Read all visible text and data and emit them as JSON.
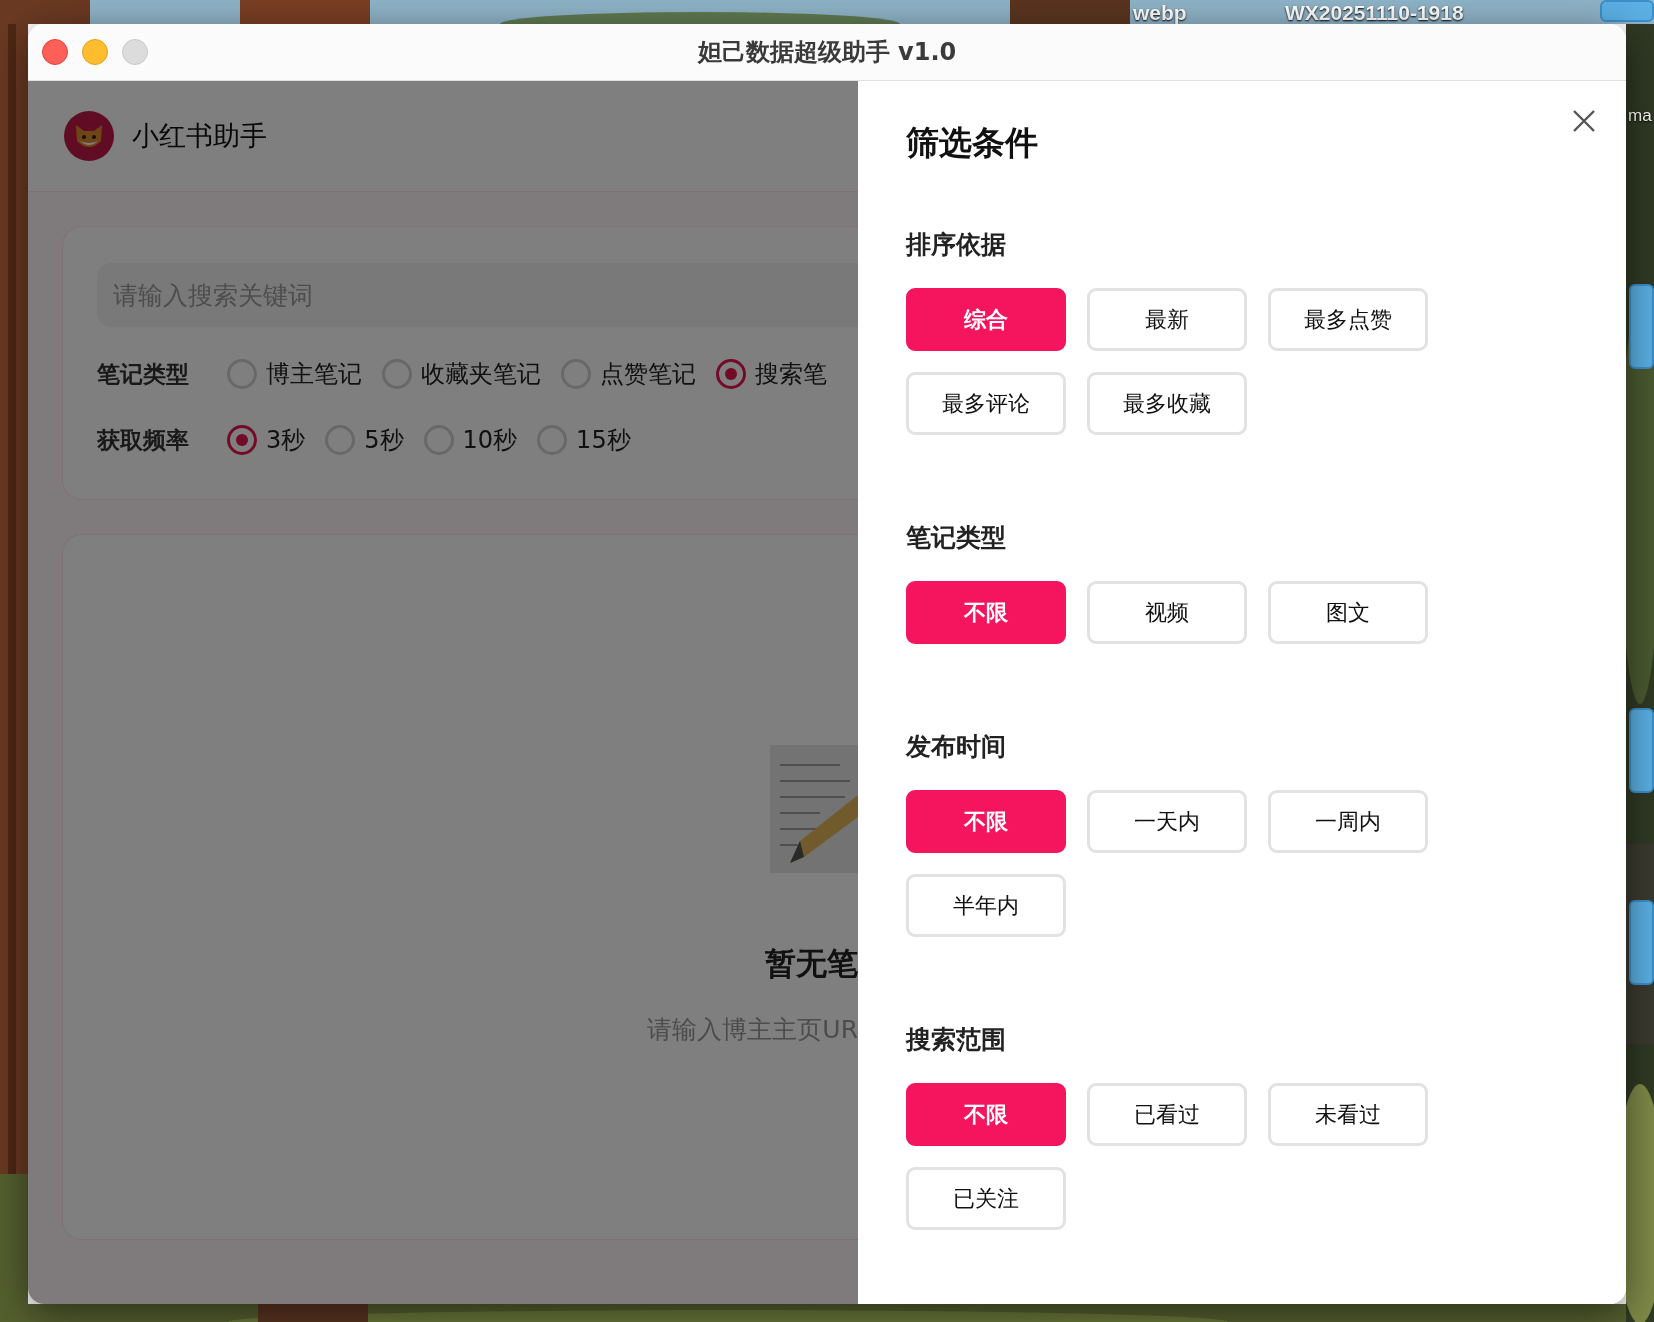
{
  "desktop": {
    "labels": [
      "webp",
      "WX20251110-1918",
      "ma"
    ]
  },
  "window": {
    "title": "妲己数据超级助手 v1.0"
  },
  "app": {
    "name": "小红书助手"
  },
  "search": {
    "placeholder": "请输入搜索关键词"
  },
  "options": [
    {
      "label": "笔记类型",
      "choices": [
        {
          "label": "博主笔记",
          "selected": false
        },
        {
          "label": "收藏夹笔记",
          "selected": false
        },
        {
          "label": "点赞笔记",
          "selected": false
        },
        {
          "label": "搜索笔",
          "selected": true
        }
      ]
    },
    {
      "label": "获取频率",
      "choices": [
        {
          "label": "3秒",
          "selected": true
        },
        {
          "label": "5秒",
          "selected": false
        },
        {
          "label": "10秒",
          "selected": false
        },
        {
          "label": "15秒",
          "selected": false
        }
      ]
    }
  ],
  "empty": {
    "title": "暂无笔",
    "hint": "请输入博主主页UR"
  },
  "filter": {
    "title": "筛选条件",
    "groups": [
      {
        "label": "排序依据",
        "options": [
          {
            "label": "综合",
            "selected": true
          },
          {
            "label": "最新",
            "selected": false
          },
          {
            "label": "最多点赞",
            "selected": false
          },
          {
            "label": "最多评论",
            "selected": false
          },
          {
            "label": "最多收藏",
            "selected": false
          }
        ]
      },
      {
        "label": "笔记类型",
        "options": [
          {
            "label": "不限",
            "selected": true
          },
          {
            "label": "视频",
            "selected": false
          },
          {
            "label": "图文",
            "selected": false
          }
        ]
      },
      {
        "label": "发布时间",
        "options": [
          {
            "label": "不限",
            "selected": true
          },
          {
            "label": "一天内",
            "selected": false
          },
          {
            "label": "一周内",
            "selected": false
          },
          {
            "label": "半年内",
            "selected": false
          }
        ]
      },
      {
        "label": "搜索范围",
        "options": [
          {
            "label": "不限",
            "selected": true
          },
          {
            "label": "已看过",
            "selected": false
          },
          {
            "label": "未看过",
            "selected": false
          },
          {
            "label": "已关注",
            "selected": false
          }
        ]
      }
    ]
  }
}
